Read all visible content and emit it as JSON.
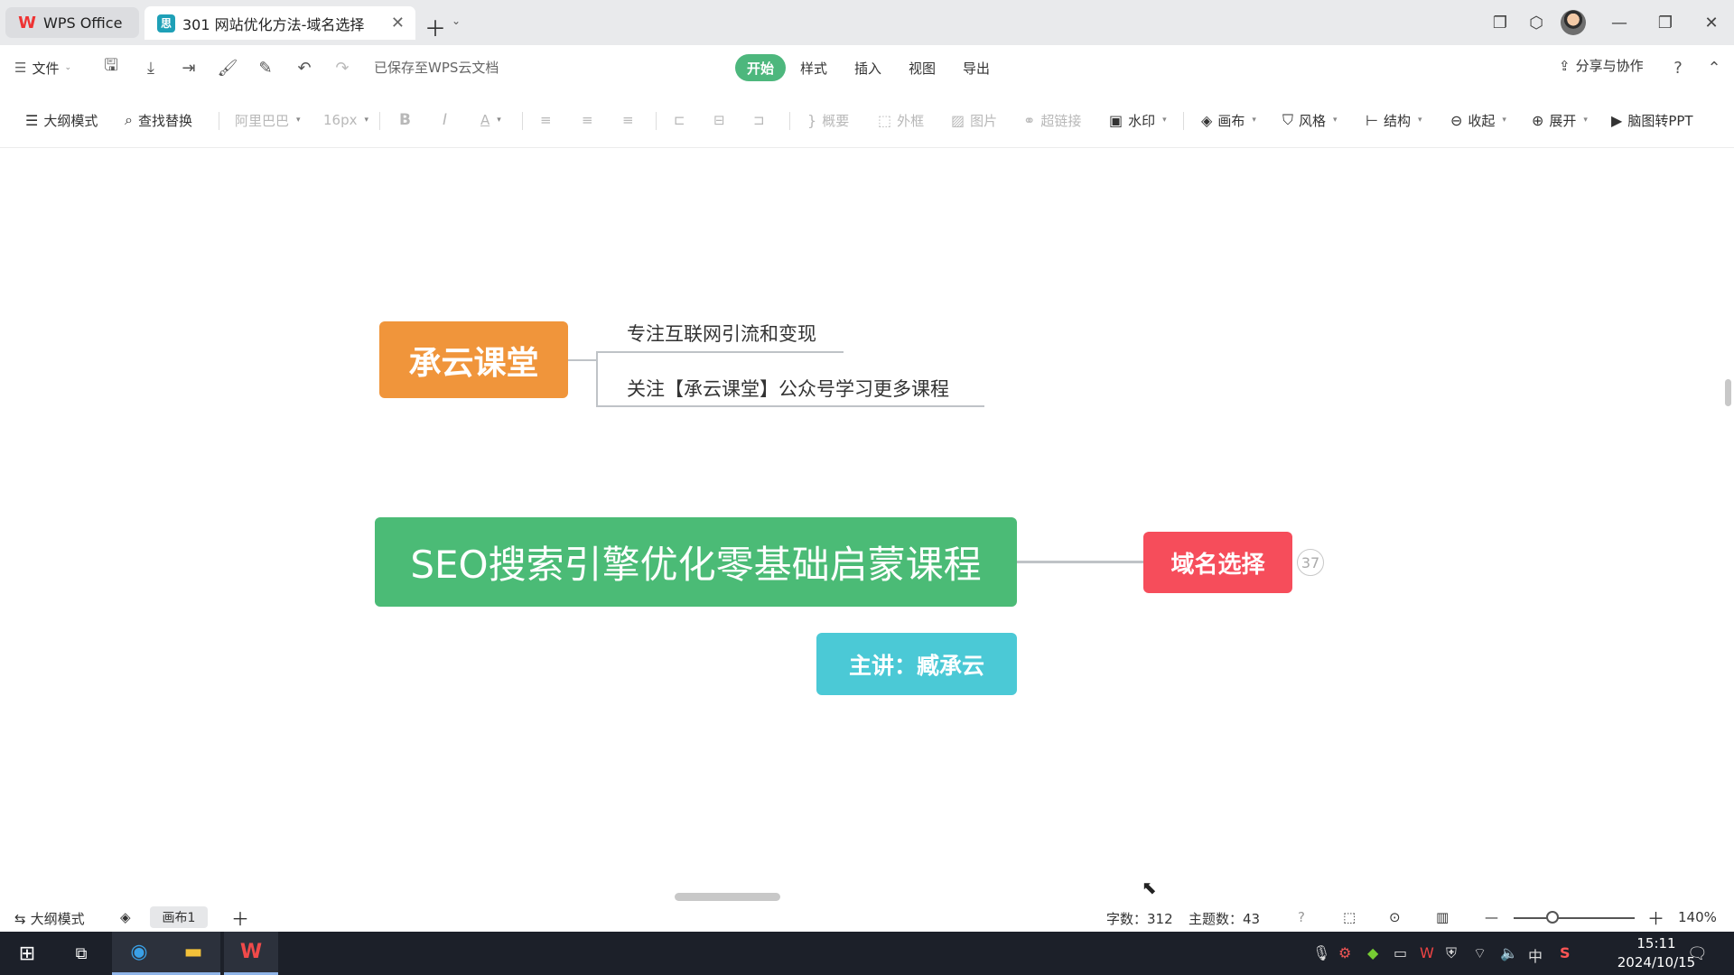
{
  "titlebar": {
    "app_tab": "WPS Office",
    "doc_tab": "301 网站优化方法-域名选择"
  },
  "menubar": {
    "file": "文件",
    "saved_status": "已保存至WPS云文档",
    "tabs": [
      "开始",
      "样式",
      "插入",
      "视图",
      "导出"
    ],
    "share": "分享与协作"
  },
  "toolbar": {
    "outline": "大纲模式",
    "find_replace": "查找替换",
    "font_family": "阿里巴巴",
    "font_size": "16px",
    "bold": "B",
    "italic": "I",
    "font_color": "A",
    "summary": "概要",
    "frame": "外框",
    "image": "图片",
    "link": "超链接",
    "watermark": "水印",
    "canvas": "画布",
    "style": "风格",
    "structure": "结构",
    "collapse": "收起",
    "expand": "展开",
    "to_ppt": "脑图转PPT"
  },
  "mindmap": {
    "brand_node": "承云课堂",
    "brand_sub1": "专注互联网引流和变现",
    "brand_sub2": "关注【承云课堂】公众号学习更多课程",
    "root_node": "SEO搜索引擎优化零基础启蒙课程",
    "domain_node": "域名选择",
    "domain_badge": "37",
    "speaker_node": "主讲：臧承云"
  },
  "statusbar": {
    "outline_mode": "大纲模式",
    "canvas_tab": "画布1",
    "word_count": "字数：312",
    "topic_count": "主题数：43",
    "zoom": "140%"
  },
  "taskbar": {
    "ime": "中",
    "time": "15:11",
    "date": "2024/10/15"
  },
  "colors": {
    "accent_green": "#4db77d",
    "brand_orange": "#f0953b",
    "root_green": "#4bbb76",
    "domain_red": "#f64d5b",
    "speaker_cyan": "#4bc9d6"
  }
}
